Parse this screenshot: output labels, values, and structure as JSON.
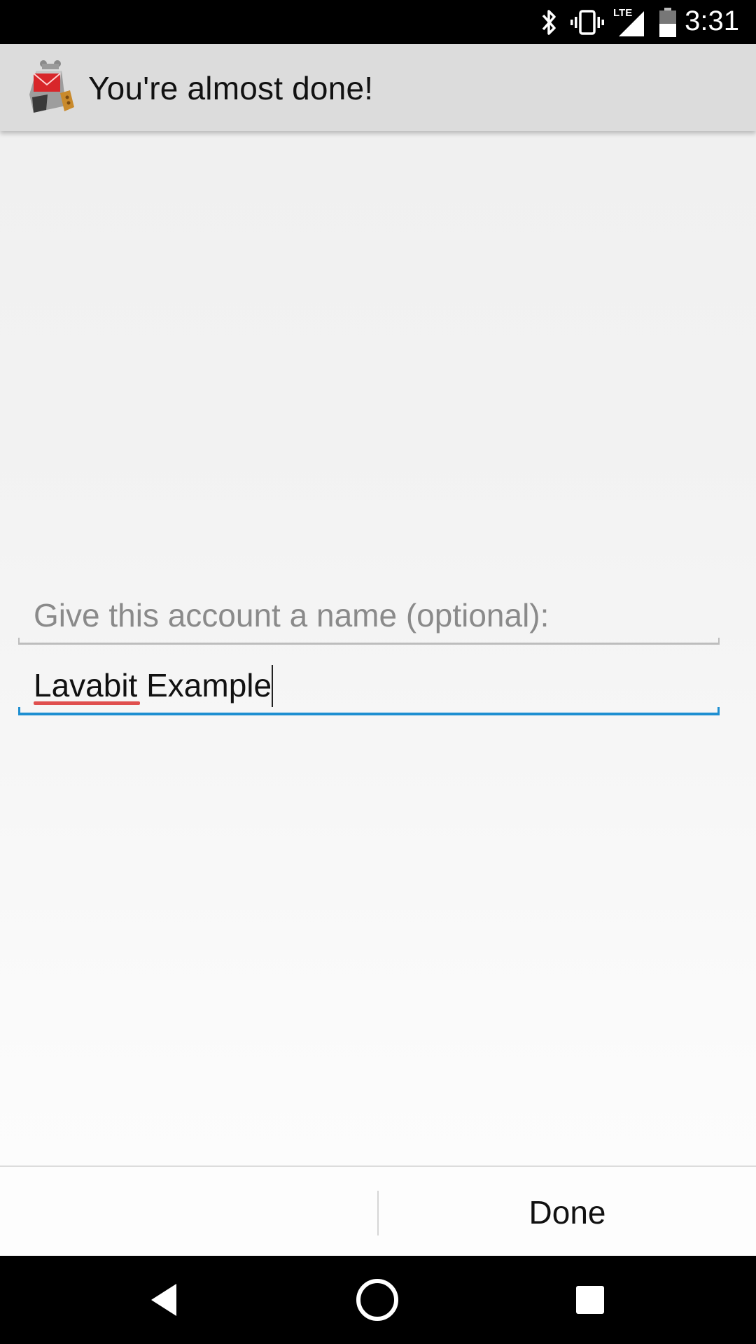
{
  "status_bar": {
    "time": "3:31",
    "network": "LTE",
    "icons": [
      "bluetooth-icon",
      "vibrate-icon",
      "lte-signal-icon",
      "battery-icon"
    ]
  },
  "action_bar": {
    "title": "You're almost done!",
    "icon": "app-mail-robot-icon"
  },
  "form": {
    "name_label": "Give this account a name (optional):",
    "name_value": "Lavabit Example"
  },
  "buttons": {
    "done_label": "Done"
  },
  "nav_bar": {
    "icons": [
      "back-icon",
      "home-icon",
      "recents-icon"
    ]
  },
  "colors": {
    "accent": "#1e8fd1",
    "spellcheck": "#e0504f",
    "action_bar_bg": "#dcdcdc",
    "hint_text": "#8a8a8a"
  }
}
